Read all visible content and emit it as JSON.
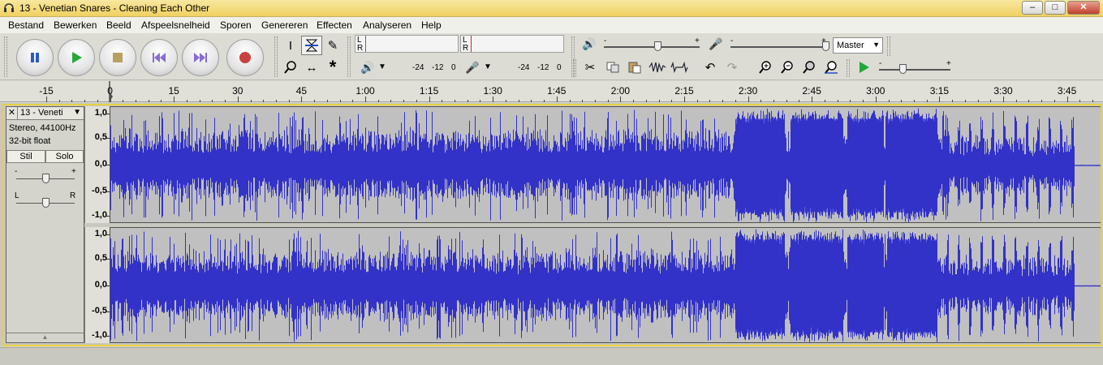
{
  "window": {
    "title": "13 - Venetian Snares - Cleaning Each Other"
  },
  "window_controls": {
    "minimize": "–",
    "maximize": "□",
    "close": "✕"
  },
  "menu": [
    "Bestand",
    "Bewerken",
    "Beeld",
    "Afspeelsnelheid",
    "Sporen",
    "Genereren",
    "Effecten",
    "Analyseren",
    "Help"
  ],
  "transport": {
    "pause": "pause-icon",
    "play": "play-icon",
    "stop": "stop-icon",
    "skip_start": "skip-to-start-icon",
    "skip_end": "skip-to-end-icon",
    "record": "record-icon"
  },
  "meters": {
    "play_L": "L",
    "play_R": "R",
    "rec_L": "L",
    "rec_R": "R",
    "scale1": [
      "-24",
      "-12",
      "0"
    ],
    "scale2": [
      "-24",
      "-12",
      "0"
    ]
  },
  "mixer": {
    "minus": "-",
    "plus": "+",
    "input_source": "Master"
  },
  "playat": {
    "minus": "-",
    "plus": "+"
  },
  "ruler_labels": [
    "-15",
    "0",
    "15",
    "30",
    "45",
    "1:00",
    "1:15",
    "1:30",
    "1:45",
    "2:00",
    "2:15",
    "2:30",
    "2:45",
    "3:00",
    "3:15",
    "3:30",
    "3:45"
  ],
  "track": {
    "name": "13 - Veneti",
    "close": "✕",
    "menu_arrow": "▼",
    "format": "Stereo, 44100Hz",
    "bitdepth": "32-bit float",
    "mute": "Stil",
    "solo": "Solo",
    "gain_minus": "-",
    "gain_plus": "+",
    "pan_L": "L",
    "pan_R": "R",
    "collapse": "▲",
    "scale": [
      "1,0",
      "0,5",
      "0,0",
      "-0,5",
      "-1,0"
    ]
  },
  "colors": {
    "waveform": "#3232c8",
    "waveform_light": "#6464dc",
    "wave_bg": "#c0c0c0"
  }
}
